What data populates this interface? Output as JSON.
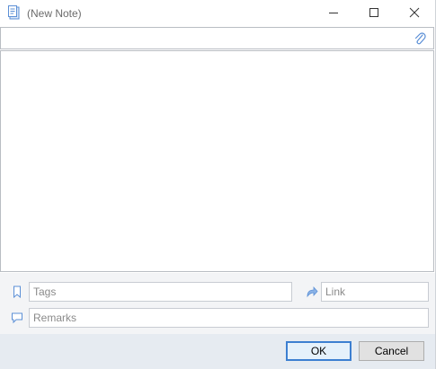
{
  "window": {
    "title": "(New Note)"
  },
  "icons": {
    "app": "note-icon",
    "minimize": "minimize-icon",
    "maximize": "maximize-icon",
    "close": "close-icon",
    "attach": "paperclip-icon",
    "tags": "bookmark-icon",
    "link": "link-arrow-icon",
    "remarks": "speech-bubble-icon"
  },
  "colors": {
    "icon_accent": "#5b8fd6",
    "ok_border": "#3c7fd1",
    "panel_bg": "#f3f4f6",
    "button_bar_bg": "#e6ebf1"
  },
  "subject": {
    "value": "",
    "placeholder": ""
  },
  "body": {
    "value": ""
  },
  "fields": {
    "tags_placeholder": "Tags",
    "link_placeholder": "Link",
    "remarks_placeholder": "Remarks"
  },
  "buttons": {
    "ok": "OK",
    "cancel": "Cancel"
  }
}
